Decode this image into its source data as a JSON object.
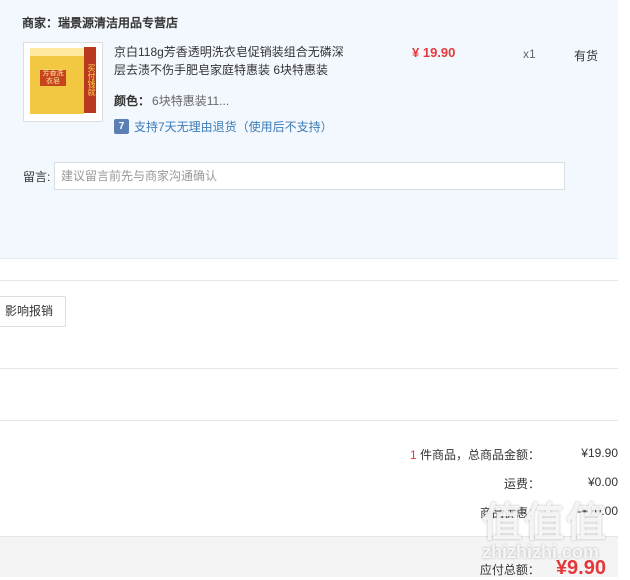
{
  "shop": {
    "label": "商家：",
    "name": "瑞景源清洁用品专营店"
  },
  "product": {
    "title": "京白118g芳香透明洗衣皂促销装组合无磷深层去渍不伤手肥皂家庭特惠装 6块特惠装",
    "price": "¥ 19.90",
    "quantity": "x1",
    "stock": "有货",
    "color_label": "颜色：",
    "color_value": "6块特惠装11...",
    "return_icon": "7",
    "return_text": "支持7天无理由退货（使用后不支持）",
    "image_texts": {
      "label": "芳香洗衣皂",
      "band": "买付钱就"
    }
  },
  "remark": {
    "label": "留言:",
    "placeholder": "建议留言前先与商家沟通确认"
  },
  "reimbursement_button": "影响报销",
  "summary": {
    "count": "1",
    "count_suffix": " 件商品，总商品金额：",
    "goods_total": "¥19.90",
    "shipping_label": "运费：",
    "shipping": "¥0.00",
    "discount_label": "商品优惠：",
    "discount": "-¥10.00"
  },
  "total": {
    "label": "应付总额：",
    "value": "¥9.90"
  },
  "watermark": {
    "chars": "值值值",
    "site": "zhizhizhi.com"
  },
  "colors": {
    "accent_red": "#e4393c",
    "panel_bg": "#f3f8fe",
    "link_blue": "#3b7bb8"
  }
}
